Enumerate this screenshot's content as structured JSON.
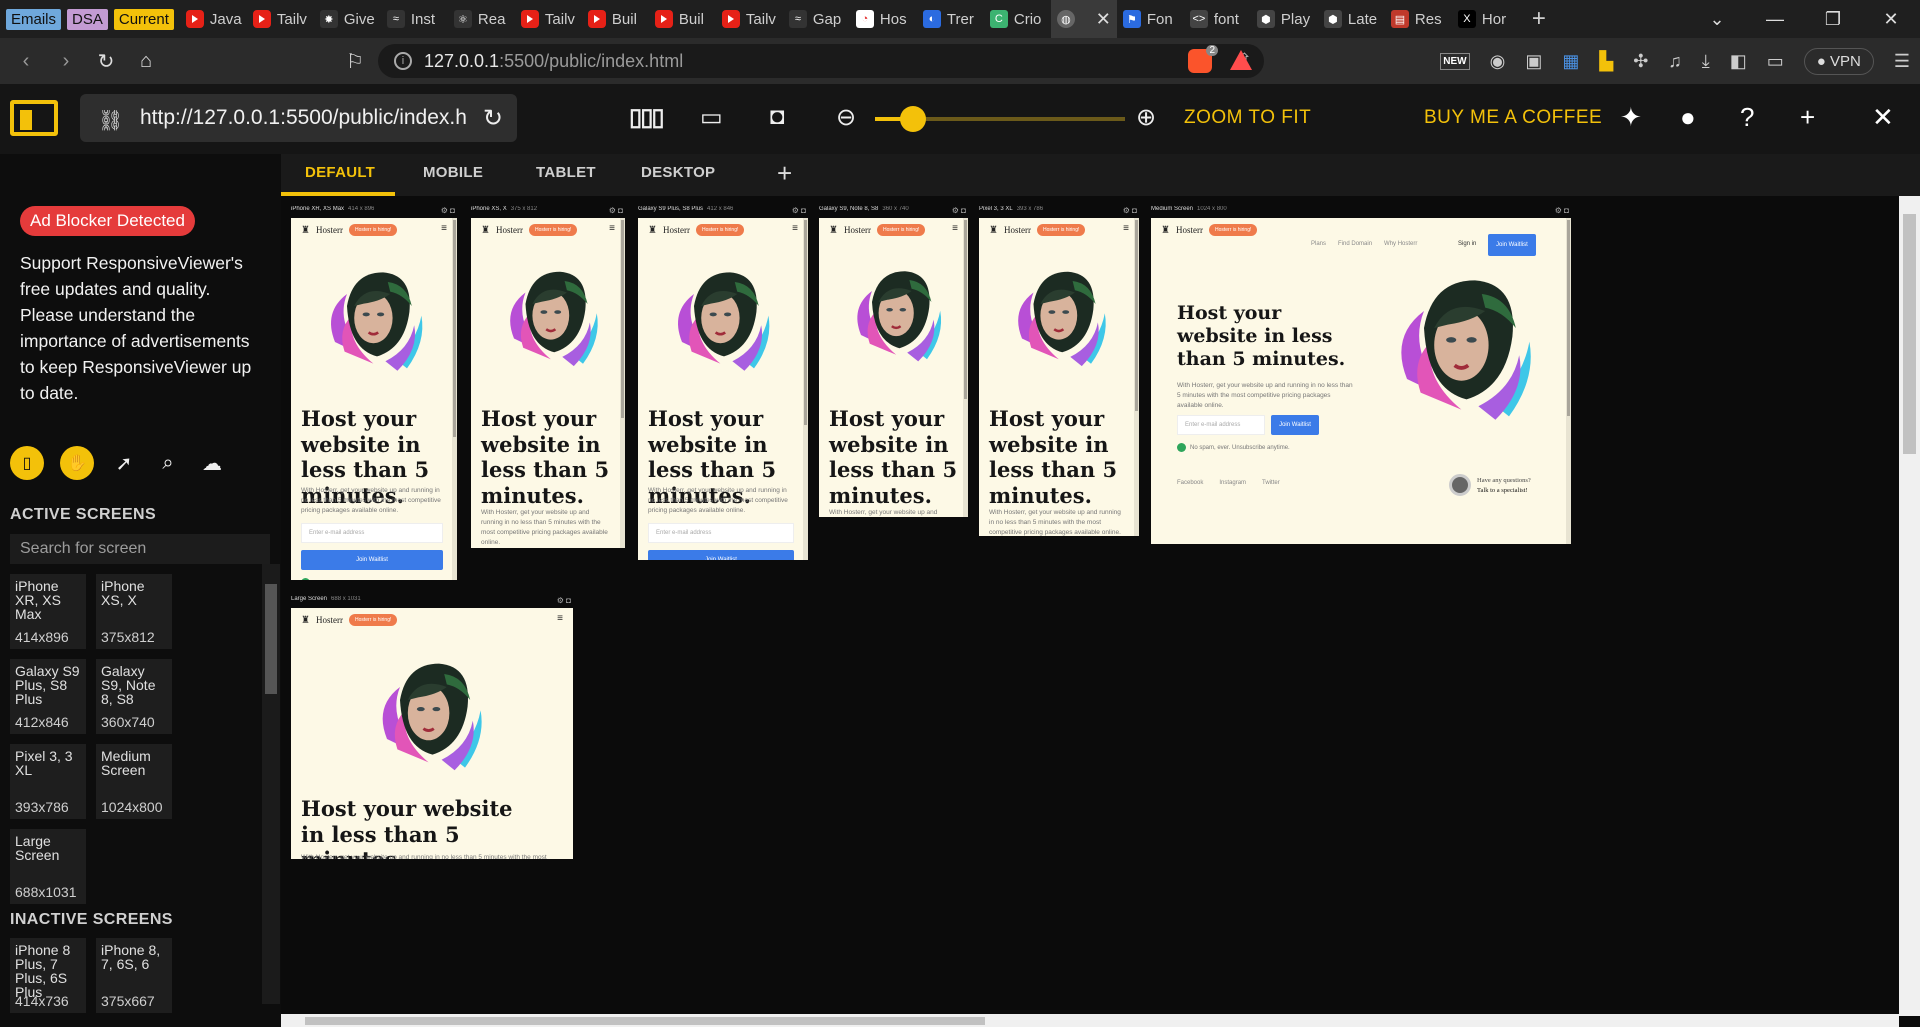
{
  "browser": {
    "bookmarks": [
      {
        "label": "Emails",
        "color": "#6fa8dc"
      },
      {
        "label": "DSA",
        "color": "#c39bd3"
      },
      {
        "label": "Current",
        "color": "#f3c10a"
      }
    ],
    "tabs": [
      {
        "label": "Java",
        "icon": "youtube-icon"
      },
      {
        "label": "Tailv",
        "icon": "youtube-icon"
      },
      {
        "label": "Give",
        "icon": "spark-icon"
      },
      {
        "label": "Inst",
        "icon": "tailwind-icon"
      },
      {
        "label": "Rea",
        "icon": "react-icon"
      },
      {
        "label": "Tailv",
        "icon": "youtube-icon"
      },
      {
        "label": "Buil",
        "icon": "youtube-icon"
      },
      {
        "label": "Buil",
        "icon": "youtube-icon"
      },
      {
        "label": "Tailv",
        "icon": "youtube-icon"
      },
      {
        "label": "Gap",
        "icon": "tailwind-icon"
      },
      {
        "label": "Hos",
        "icon": "hosterr-icon"
      },
      {
        "label": "Trer",
        "icon": "trending-icon"
      },
      {
        "label": "Crio",
        "icon": "crio-icon"
      }
    ],
    "active_tab": {
      "label": "",
      "icon": "globe-icon"
    },
    "tabs_after": [
      {
        "label": "Fon",
        "icon": "flag-icon"
      },
      {
        "label": "font",
        "icon": "code-icon"
      },
      {
        "label": "Play",
        "icon": "game-icon"
      },
      {
        "label": "Late",
        "icon": "game-icon"
      },
      {
        "label": "Res",
        "icon": "responsive-icon"
      },
      {
        "label": "Hor",
        "icon": "x-icon"
      }
    ],
    "url_host": "127.0.0.1",
    "url_path": ":5500/public/index.html",
    "shield_count": "2",
    "vpn_label": "VPN",
    "new_badge": "NEW"
  },
  "viewer": {
    "url": "http://127.0.0.1:5500/public/index.h",
    "zoom_fraction": 0.15,
    "zoom_to_fit": "ZOOM TO FIT",
    "buy_coffee": "BUY ME A COFFEE",
    "view_tabs": [
      "DEFAULT",
      "MOBILE",
      "TABLET",
      "DESKTOP"
    ],
    "active_view_tab": "DEFAULT"
  },
  "sidebar": {
    "adblock": "Ad Blocker Detected",
    "support": "Support ResponsiveViewer's free updates and quality. Please understand the importance of advertisements to keep ResponsiveViewer up to date.",
    "active_heading": "ACTIVE SCREENS",
    "search_placeholder": "Search for screen",
    "active_screens": [
      {
        "name": "iPhone XR, XS Max",
        "size": "414x896"
      },
      {
        "name": "iPhone XS, X",
        "size": "375x812"
      },
      {
        "name": "Galaxy S9 Plus, S8 Plus",
        "size": "412x846"
      },
      {
        "name": "Galaxy S9, Note 8, S8",
        "size": "360x740"
      },
      {
        "name": "Pixel 3, 3 XL",
        "size": "393x786"
      },
      {
        "name": "Medium Screen",
        "size": "1024x800"
      },
      {
        "name": "Large Screen",
        "size": "688x1031"
      }
    ],
    "inactive_heading": "INACTIVE SCREENS",
    "inactive_screens": [
      {
        "name": "iPhone 8 Plus, 7 Plus, 6S Plus",
        "size": "414x736"
      },
      {
        "name": "iPhone 8, 7, 6S, 6",
        "size": "375x667"
      }
    ]
  },
  "site": {
    "brand": "Hosterr",
    "badge": "Hosterr is hiring!",
    "title": "Host your website in less than 5 minutes.",
    "description": "With Hosterr, get your website up and running in no less than 5 minutes with the most competitive pricing packages available online.",
    "email_placeholder": "Enter e-mail address",
    "join": "Join Waitlist",
    "nospam": "No spam, ever. Unsubscribe anytime.",
    "nav": [
      "Plans",
      "Find Domain",
      "Why Hosterr"
    ],
    "signin": "Sign in",
    "social": [
      "Facebook",
      "Instagram",
      "Twitter"
    ],
    "question": "Have any questions?",
    "specialist": "Talk to a specialist!"
  },
  "devices": [
    {
      "name": "iPhone XR, XS Max",
      "size": "414 x 896"
    },
    {
      "name": "iPhone XS, X",
      "size": "375 x 812"
    },
    {
      "name": "Galaxy S9 Plus, S8 Plus",
      "size": "412 x 846"
    },
    {
      "name": "Galaxy S9, Note 8, S8",
      "size": "360 x 740"
    },
    {
      "name": "Pixel 3, 3 XL",
      "size": "393 x 786"
    },
    {
      "name": "Medium Screen",
      "size": "1024 x 800"
    },
    {
      "name": "Large Screen",
      "size": "688 x 1031"
    }
  ],
  "colors": {
    "accent": "#f3c10a",
    "danger": "#e53b3b",
    "cta": "#3b7be8",
    "page_bg": "#fdf9e6"
  }
}
